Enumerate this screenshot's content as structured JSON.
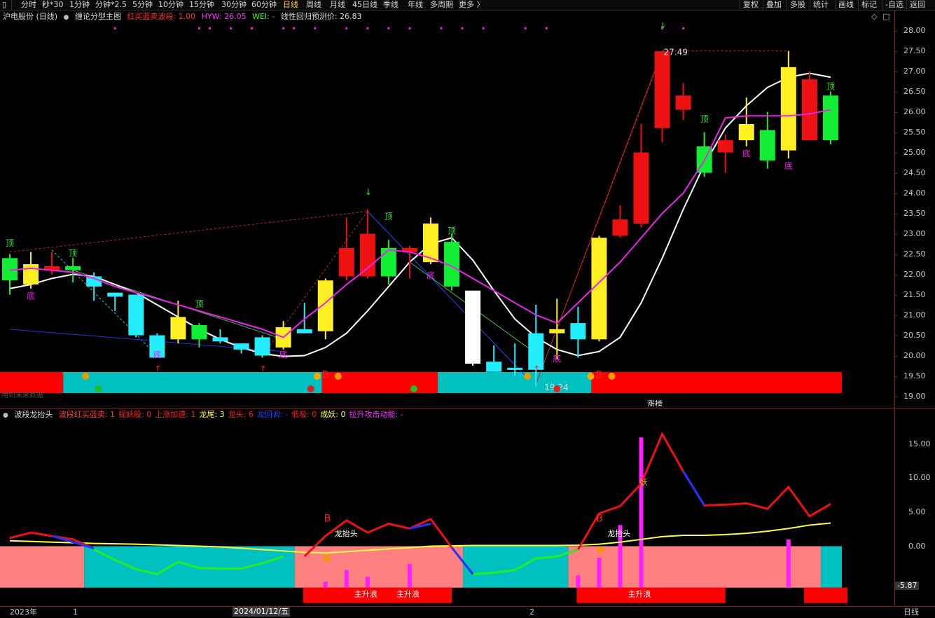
{
  "toolbar": {
    "left": [
      "分时",
      "秒*30",
      "1分钟",
      "分钟*2.5",
      "5分钟",
      "10分钟",
      "15分钟",
      "30分钟",
      "60分钟",
      "日线",
      "周线",
      "月线",
      "45日线",
      "季线",
      "年线",
      "多周期",
      "更多 〉"
    ],
    "active": "日线",
    "right": [
      "复权",
      "叠加",
      "多股",
      "统计",
      "画线",
      "标记",
      "-自选",
      "返回"
    ]
  },
  "main_header": {
    "stock": "沪电股份 (日线)",
    "indicator": "缠论分型主图",
    "sig_label": "红买蓝卖波段: 1.00",
    "hyw_label": "HYW: 26.05",
    "wei_label": "WEI: -",
    "pred_label": "线性回归预测价: 26.83"
  },
  "main_axis": {
    "ticks": [
      "28.00",
      "27.50",
      "27.00",
      "26.50",
      "26.00",
      "25.50",
      "25.00",
      "24.50",
      "24.00",
      "23.50",
      "23.00",
      "22.50",
      "22.00",
      "21.50",
      "21.00",
      "20.50",
      "20.00",
      "19.50",
      "19.00"
    ]
  },
  "price_annotations": {
    "high": "27.49",
    "low": "19.24"
  },
  "labels": {
    "top": "顶",
    "bottom": "底",
    "buy": "B",
    "limit_up": "涨榜",
    "faded": "用到未来数据"
  },
  "ind_header": {
    "name": "波段龙抬头",
    "items": [
      {
        "text": "波段红买蓝卖: 1",
        "color": "#ff4040"
      },
      {
        "text": "捉妖股: 0",
        "color": "#ff2020"
      },
      {
        "text": "上涨加速: 1",
        "color": "#ff2020"
      },
      {
        "text": "龙尾: 3",
        "color": "#ffff40"
      },
      {
        "text": "龙头: 6",
        "color": "#ff2020"
      },
      {
        "text": "龙回调: -",
        "color": "#2040ff"
      },
      {
        "text": "低吸: 0",
        "color": "#ff2020"
      },
      {
        "text": "成妖: 0",
        "color": "#ffff40"
      },
      {
        "text": "拉升攻击动能: -",
        "color": "#ff30ff"
      }
    ]
  },
  "ind_axis": {
    "ticks": [
      "15.00",
      "10.00",
      "5.00",
      "0.00"
    ],
    "current": "-5.87"
  },
  "ind_labels": {
    "dragon": "龙抬头",
    "wave": "主升浪",
    "yao": "妖",
    "buy": "B"
  },
  "x_axis": {
    "labels": [
      "2023年",
      "1",
      "2024/01/12/五",
      "2"
    ],
    "period": "日线"
  },
  "chart_data": {
    "type": "candlestick",
    "ylim": [
      18.75,
      28.2
    ],
    "candles": [
      {
        "o": 21.85,
        "h": 22.5,
        "l": 21.5,
        "c": 22.4,
        "col": "green"
      },
      {
        "o": 21.75,
        "h": 22.55,
        "l": 21.65,
        "c": 22.25,
        "col": "yellow"
      },
      {
        "o": 22.2,
        "h": 22.55,
        "l": 22.0,
        "c": 22.1,
        "col": "red"
      },
      {
        "o": 22.1,
        "h": 22.4,
        "l": 21.8,
        "c": 22.2,
        "col": "green"
      },
      {
        "o": 21.95,
        "h": 22.05,
        "l": 21.35,
        "c": 21.7,
        "col": "cyan"
      },
      {
        "o": 21.55,
        "h": 21.55,
        "l": 21.1,
        "c": 21.45,
        "col": "cyan"
      },
      {
        "o": 21.5,
        "h": 21.5,
        "l": 20.45,
        "c": 20.5,
        "col": "cyan"
      },
      {
        "o": 20.5,
        "h": 20.55,
        "l": 19.95,
        "c": 19.95,
        "col": "cyan"
      },
      {
        "o": 20.4,
        "h": 21.35,
        "l": 20.3,
        "c": 20.95,
        "col": "yellow"
      },
      {
        "o": 20.4,
        "h": 20.8,
        "l": 20.2,
        "c": 20.75,
        "col": "green"
      },
      {
        "o": 20.45,
        "h": 20.65,
        "l": 20.3,
        "c": 20.35,
        "col": "cyan"
      },
      {
        "o": 20.3,
        "h": 20.3,
        "l": 20.05,
        "c": 20.15,
        "col": "cyan"
      },
      {
        "o": 20.45,
        "h": 20.5,
        "l": 19.95,
        "c": 20.0,
        "col": "cyan"
      },
      {
        "o": 20.2,
        "h": 20.85,
        "l": 20.15,
        "c": 20.7,
        "col": "yellow"
      },
      {
        "o": 20.65,
        "h": 21.3,
        "l": 20.55,
        "c": 20.55,
        "col": "cyan"
      },
      {
        "o": 20.6,
        "h": 21.9,
        "l": 20.4,
        "c": 21.85,
        "col": "yellow"
      },
      {
        "o": 21.95,
        "h": 23.4,
        "l": 21.85,
        "c": 22.65,
        "col": "red"
      },
      {
        "o": 21.95,
        "h": 23.6,
        "l": 21.9,
        "c": 23.0,
        "col": "red"
      },
      {
        "o": 21.95,
        "h": 22.85,
        "l": 21.75,
        "c": 22.65,
        "col": "green"
      },
      {
        "o": 22.55,
        "h": 22.7,
        "l": 21.9,
        "c": 22.65,
        "col": "red"
      },
      {
        "o": 22.3,
        "h": 23.4,
        "l": 22.25,
        "c": 23.25,
        "col": "yellow"
      },
      {
        "o": 22.8,
        "h": 23.0,
        "l": 21.6,
        "c": 21.7,
        "col": "green"
      },
      {
        "o": 21.6,
        "h": 21.6,
        "l": 19.75,
        "c": 19.8,
        "col": "white"
      },
      {
        "o": 19.85,
        "h": 20.25,
        "l": 19.6,
        "c": 19.6,
        "col": "cyan"
      },
      {
        "o": 19.7,
        "h": 20.3,
        "l": 19.5,
        "c": 19.65,
        "col": "cyan"
      },
      {
        "o": 19.65,
        "h": 21.25,
        "l": 19.24,
        "c": 20.55,
        "col": "cyan"
      },
      {
        "o": 20.55,
        "h": 21.4,
        "l": 19.9,
        "c": 20.65,
        "col": "yellow"
      },
      {
        "o": 20.4,
        "h": 21.2,
        "l": 19.95,
        "c": 20.8,
        "col": "cyan"
      },
      {
        "o": 20.4,
        "h": 22.95,
        "l": 20.35,
        "c": 22.9,
        "col": "yellow"
      },
      {
        "o": 22.95,
        "h": 23.7,
        "l": 22.9,
        "c": 23.35,
        "col": "red"
      },
      {
        "o": 23.25,
        "h": 25.7,
        "l": 23.15,
        "c": 25.0,
        "col": "red"
      },
      {
        "o": 25.6,
        "h": 27.49,
        "l": 25.25,
        "c": 27.49,
        "col": "red"
      },
      {
        "o": 26.05,
        "h": 26.7,
        "l": 25.8,
        "c": 26.4,
        "col": "red"
      },
      {
        "o": 24.5,
        "h": 25.5,
        "l": 24.4,
        "c": 25.15,
        "col": "green"
      },
      {
        "o": 25.0,
        "h": 25.45,
        "l": 24.5,
        "c": 25.3,
        "col": "red"
      },
      {
        "o": 25.3,
        "h": 26.35,
        "l": 25.15,
        "c": 25.7,
        "col": "yellow"
      },
      {
        "o": 24.8,
        "h": 26.0,
        "l": 24.6,
        "c": 25.55,
        "col": "green"
      },
      {
        "o": 25.05,
        "h": 27.5,
        "l": 24.85,
        "c": 27.1,
        "col": "yellow"
      },
      {
        "o": 25.3,
        "h": 27.0,
        "l": 25.3,
        "c": 26.8,
        "col": "red"
      },
      {
        "o": 25.3,
        "h": 26.5,
        "l": 25.2,
        "c": 26.4,
        "col": "green"
      }
    ],
    "hyw_line": [
      22.1,
      22.15,
      22.1,
      22.05,
      21.9,
      21.7,
      21.55,
      21.4,
      21.25,
      21.1,
      20.95,
      20.8,
      20.65,
      20.45,
      20.9,
      21.3,
      21.75,
      22.15,
      22.6,
      22.55,
      22.4,
      22.2,
      21.9,
      21.6,
      21.3,
      21.0,
      20.8,
      21.3,
      21.8,
      22.3,
      22.9,
      23.5,
      24.0,
      24.8,
      25.85,
      25.9,
      25.9,
      25.9,
      25.95,
      26.05
    ],
    "white_line": [
      21.65,
      21.75,
      21.9,
      22.0,
      21.95,
      21.75,
      21.55,
      21.25,
      20.95,
      20.65,
      20.4,
      20.2,
      20.05,
      19.98,
      20.0,
      20.2,
      20.55,
      21.1,
      21.7,
      22.3,
      22.75,
      22.9,
      22.35,
      21.6,
      20.9,
      20.45,
      20.15,
      20.0,
      20.1,
      20.45,
      21.3,
      22.4,
      23.6,
      24.7,
      25.6,
      26.15,
      26.6,
      26.85,
      26.95,
      26.85
    ],
    "indicator": {
      "ylim": [
        -8.5,
        18.5
      ],
      "main_line": [
        1.2,
        2.0,
        1.5,
        1.0,
        -0.3,
        null,
        null,
        null,
        null,
        null,
        null,
        null,
        null,
        null,
        -1.5,
        1.5,
        3.8,
        2.0,
        3.3,
        2.6,
        4.0,
        -0.2,
        -4.1,
        null,
        null,
        null,
        null,
        -0.5,
        4.8,
        5.9,
        9.2,
        16.5,
        11.0,
        6.0,
        6.1,
        6.3,
        5.5,
        8.7,
        4.4,
        6.2
      ],
      "yellow_line": [
        0.8,
        0.7,
        0.6,
        0.5,
        0.4,
        0.35,
        0.3,
        0.2,
        0.1,
        0.0,
        -0.1,
        -0.3,
        -0.5,
        -0.7,
        -0.9,
        -1.0,
        -0.8,
        -0.6,
        -0.4,
        -0.2,
        0.0,
        0.05,
        0.1,
        0.1,
        0.1,
        0.1,
        0.1,
        0.15,
        0.3,
        0.6,
        1.0,
        1.4,
        1.6,
        1.6,
        1.7,
        1.9,
        2.2,
        2.6,
        3.1,
        3.4
      ],
      "green_line": [
        null,
        null,
        null,
        null,
        -0.5,
        -2.0,
        -3.4,
        -4.1,
        -2.3,
        -3.2,
        -3.3,
        -3.3,
        -2.5,
        -1.5,
        null,
        null,
        null,
        null,
        null,
        null,
        null,
        null,
        -4.1,
        -3.9,
        -3.5,
        -1.8,
        -1.5,
        -0.5,
        null,
        null,
        null,
        null,
        null,
        null,
        null,
        null,
        null,
        null,
        null,
        null
      ],
      "magenta_bars": [
        null,
        null,
        null,
        null,
        null,
        null,
        null,
        null,
        null,
        null,
        null,
        null,
        null,
        null,
        null,
        -5.2,
        -3.5,
        -4.5,
        null,
        -2.6,
        null,
        null,
        null,
        null,
        null,
        null,
        null,
        -4.3,
        -1.7,
        3.1,
        16.0,
        null,
        null,
        null,
        null,
        null,
        null,
        1.0,
        null,
        null
      ],
      "zones": [
        {
          "from": 0,
          "to": 4,
          "color": "pink"
        },
        {
          "from": 4,
          "to": 14,
          "color": "cyan"
        },
        {
          "from": 14,
          "to": 22,
          "color": "pink"
        },
        {
          "from": 22,
          "to": 27,
          "color": "cyan"
        },
        {
          "from": 27,
          "to": 39,
          "color": "pink"
        },
        {
          "from": 39,
          "to": 40,
          "color": "cyan"
        }
      ]
    }
  }
}
